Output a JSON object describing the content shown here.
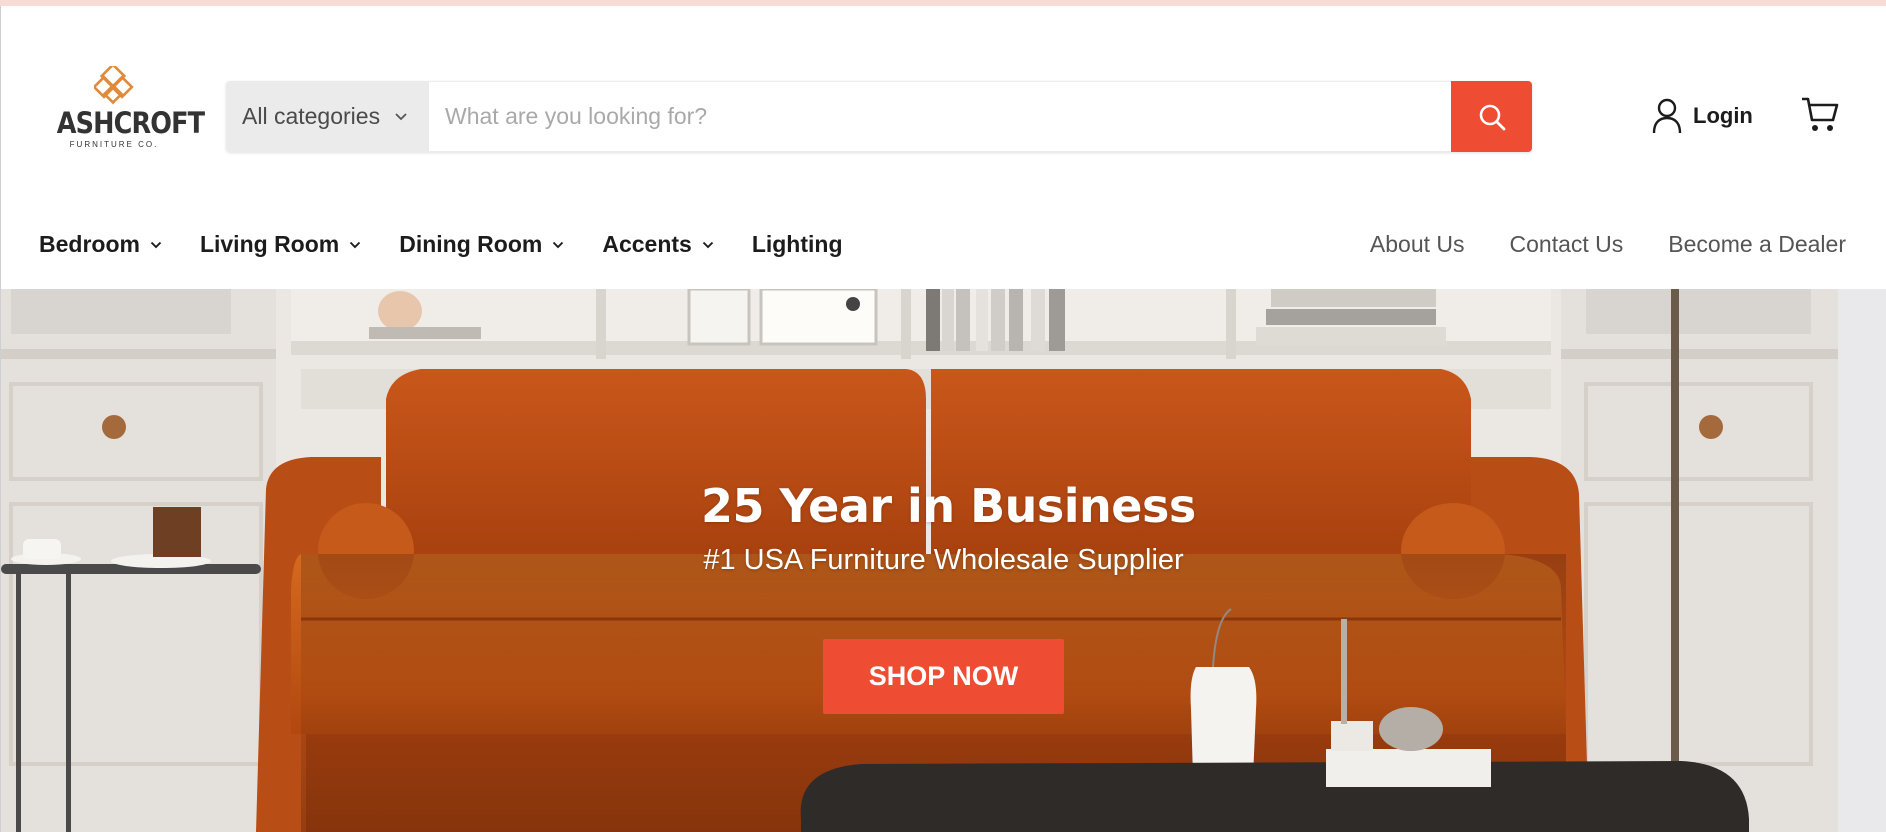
{
  "brand": {
    "name": "ASHCROFT",
    "tagline": "FURNITURE CO.",
    "accent_color": "#ee4c33"
  },
  "search": {
    "category_label": "All categories",
    "placeholder": "What are you looking for?",
    "value": ""
  },
  "account": {
    "login_label": "Login"
  },
  "icons": {
    "search": "search-icon",
    "user": "user-icon",
    "cart": "cart-icon",
    "chevron": "chevron-down-icon"
  },
  "nav": {
    "items": [
      {
        "label": "Bedroom"
      },
      {
        "label": "Living Room"
      },
      {
        "label": "Dining Room"
      },
      {
        "label": "Accents"
      },
      {
        "label": "Lighting"
      }
    ],
    "links": [
      {
        "label": "About Us"
      },
      {
        "label": "Contact Us"
      },
      {
        "label": "Become a Dealer"
      }
    ]
  },
  "hero": {
    "title": "25 Year in Business",
    "subtitle": "#1 USA Furniture Wholesale Supplier",
    "cta_label": "SHOP NOW"
  }
}
